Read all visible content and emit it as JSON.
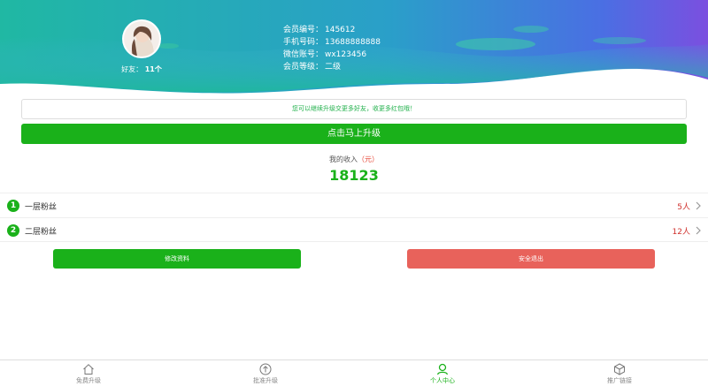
{
  "header": {
    "friends_label": "好友",
    "friends_count": "11个",
    "info": [
      {
        "key": "会员编号：",
        "value": "145612"
      },
      {
        "key": "手机号码：",
        "value": "13688888888"
      },
      {
        "key": "微信账号：",
        "value": "wx123456"
      },
      {
        "key": "会员等级：",
        "value": "二级"
      }
    ]
  },
  "notice": "您可以继续升级交更多好友，收更多红包哦！",
  "upgrade_button": "点击马上升级",
  "income": {
    "label": "我的收入",
    "unit": "（元）",
    "value": "18123"
  },
  "fans": [
    {
      "index": "1",
      "label": "一层粉丝",
      "count": "5人"
    },
    {
      "index": "2",
      "label": "二层粉丝",
      "count": "12人"
    }
  ],
  "buttons": {
    "edit": "修改资料",
    "logout": "安全退出"
  },
  "tabs": [
    {
      "label": "免费升级",
      "icon": "home-icon"
    },
    {
      "label": "批准升级",
      "icon": "upload-icon"
    },
    {
      "label": "个人中心",
      "icon": "user-icon",
      "active": true
    },
    {
      "label": "推广链接",
      "icon": "cube-icon"
    }
  ],
  "colors": {
    "accent": "#1ab11a",
    "danger": "#e8625b",
    "count": "#d0312d",
    "header_teal": "#20b8a3",
    "header_purple": "#6a4be0"
  }
}
